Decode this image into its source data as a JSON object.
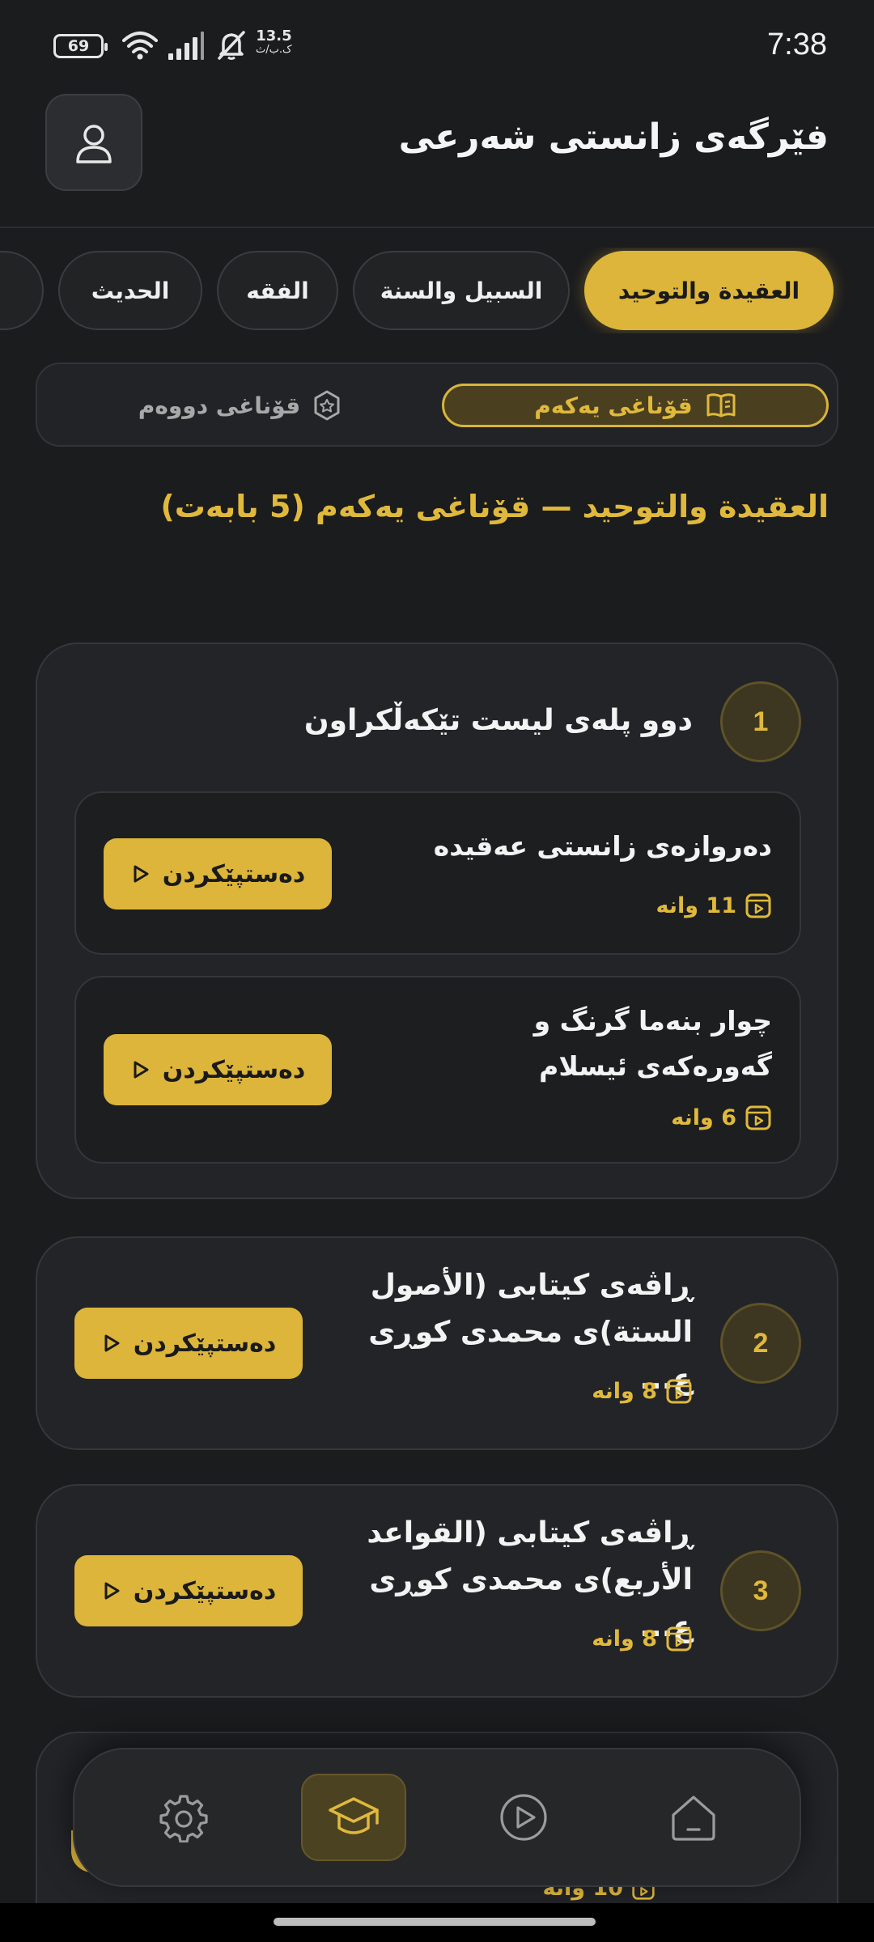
{
  "status_bar": {
    "battery": "69",
    "net_speed": "13.5",
    "net_unit": "ک.ب/ث",
    "time": "7:38"
  },
  "header": {
    "title": "فێرگەی زانستی شەرعی"
  },
  "categories": [
    {
      "label": "العقيدة والتوحيد",
      "active": true
    },
    {
      "label": "السبيل والسنة",
      "active": false
    },
    {
      "label": "الفقه",
      "active": false
    },
    {
      "label": "الحديث",
      "active": false
    }
  ],
  "stages": {
    "first": "قۆناغی یەکەم",
    "second": "قۆناغی دووەم"
  },
  "section_heading": "العقيدة والتوحيد — قۆناغی یەکەم (5 بابەت)",
  "cards": [
    {
      "number": "1",
      "title": "دوو پلەی لیست تێکەڵکراون",
      "items": [
        {
          "title": "دەروازەی زانستی عەقیدە",
          "lessons": "11 وانە",
          "button": "دەستپێکردن"
        },
        {
          "title": "چوار بنەما گرنگ و گەورەکەی ئیسلام",
          "lessons": "6 وانە",
          "button": "دەستپێکردن"
        }
      ]
    },
    {
      "number": "2",
      "title": "ڕاڤەی کیتابی (الأصول الستة)ی محمدی کوڕی ع...",
      "lessons": "8 وانە",
      "button": "دەستپێکردن"
    },
    {
      "number": "3",
      "title": "ڕاڤەی کیتابی (القواعد الأربع)ی محمدی کوڕی ع...",
      "lessons": "8 وانە",
      "button": "دەستپێکردن"
    }
  ],
  "peek_card": {
    "lessons": "10 وانە"
  },
  "colors": {
    "accent": "#dcb53a",
    "background": "#1b1c1e",
    "card": "#232427"
  },
  "bottom_nav": [
    "settings-icon",
    "graduation-cap-icon",
    "play-icon",
    "home-icon"
  ]
}
